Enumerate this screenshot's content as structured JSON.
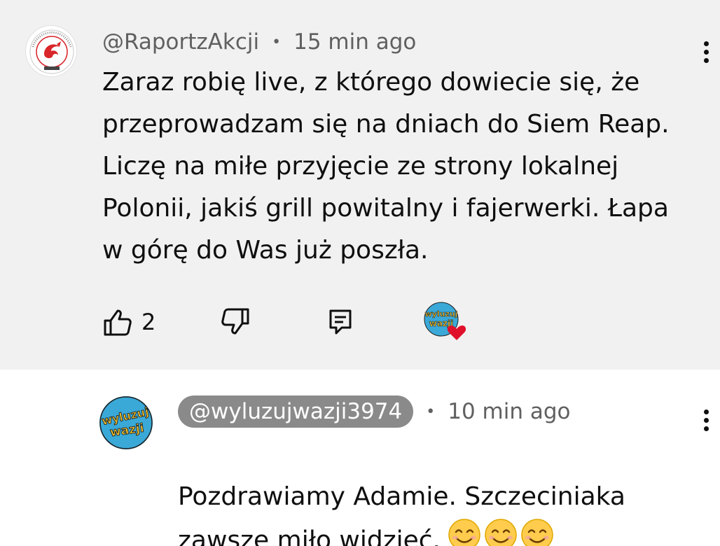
{
  "main_comment": {
    "author": "@RaportzAkcji",
    "separator": "•",
    "time": "15 min ago",
    "text": "Zaraz robię live, z którego dowiecie się, że\nprzeprowadzam się na dniach do Siem Reap.\nLiczę na miłe przyjęcie ze strony lokalnej\nPolonii, jakiś grill powitalny i fajerwerki. Łapa\nw górę do Was już poszła.",
    "like_count": "2",
    "icons": {
      "like": "thumbs-up-icon",
      "dislike": "thumbs-down-icon",
      "reply": "reply-icon",
      "menu": "more-vertical-icon",
      "creator_heart": "creator-heart-icon"
    }
  },
  "reply_comment": {
    "author": "@wyluzujwazji3974",
    "separator": "•",
    "time": "10 min ago",
    "text": "Pozdrawiamy Adamie. Szczeciniaka\nzawsze miło widzieć.",
    "emojis": [
      "😊",
      "😊",
      "😊"
    ]
  },
  "colors": {
    "main_background": "#f1f1f1",
    "reply_background": "#ffffff",
    "handle_pill": "#8a8a8a",
    "heart": "#e0102a",
    "avatar_accent": "#d8262a",
    "avatar_reply_bg": "#3aa9d8",
    "avatar_reply_text": "#f2c230"
  }
}
